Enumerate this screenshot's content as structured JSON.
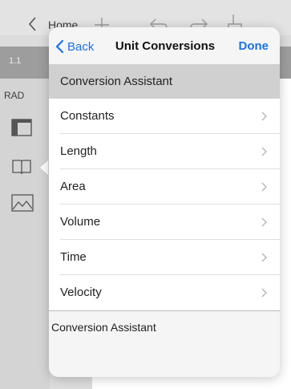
{
  "app": {
    "nav_label": "Home",
    "tab_number": "1.1",
    "angle_mode": "RAD"
  },
  "popover": {
    "back_label": "Back",
    "title": "Unit Conversions",
    "done_label": "Done",
    "section_header": "Conversion Assistant",
    "items": [
      {
        "label": "Constants"
      },
      {
        "label": "Length"
      },
      {
        "label": "Area"
      },
      {
        "label": "Volume"
      },
      {
        "label": "Time"
      },
      {
        "label": "Velocity"
      }
    ],
    "footer_text": "Conversion Assistant"
  },
  "colors": {
    "accent": "#1a73e8",
    "section_header_bg": "#d0d0d0",
    "tabstrip_bg": "#9d9d9d"
  }
}
